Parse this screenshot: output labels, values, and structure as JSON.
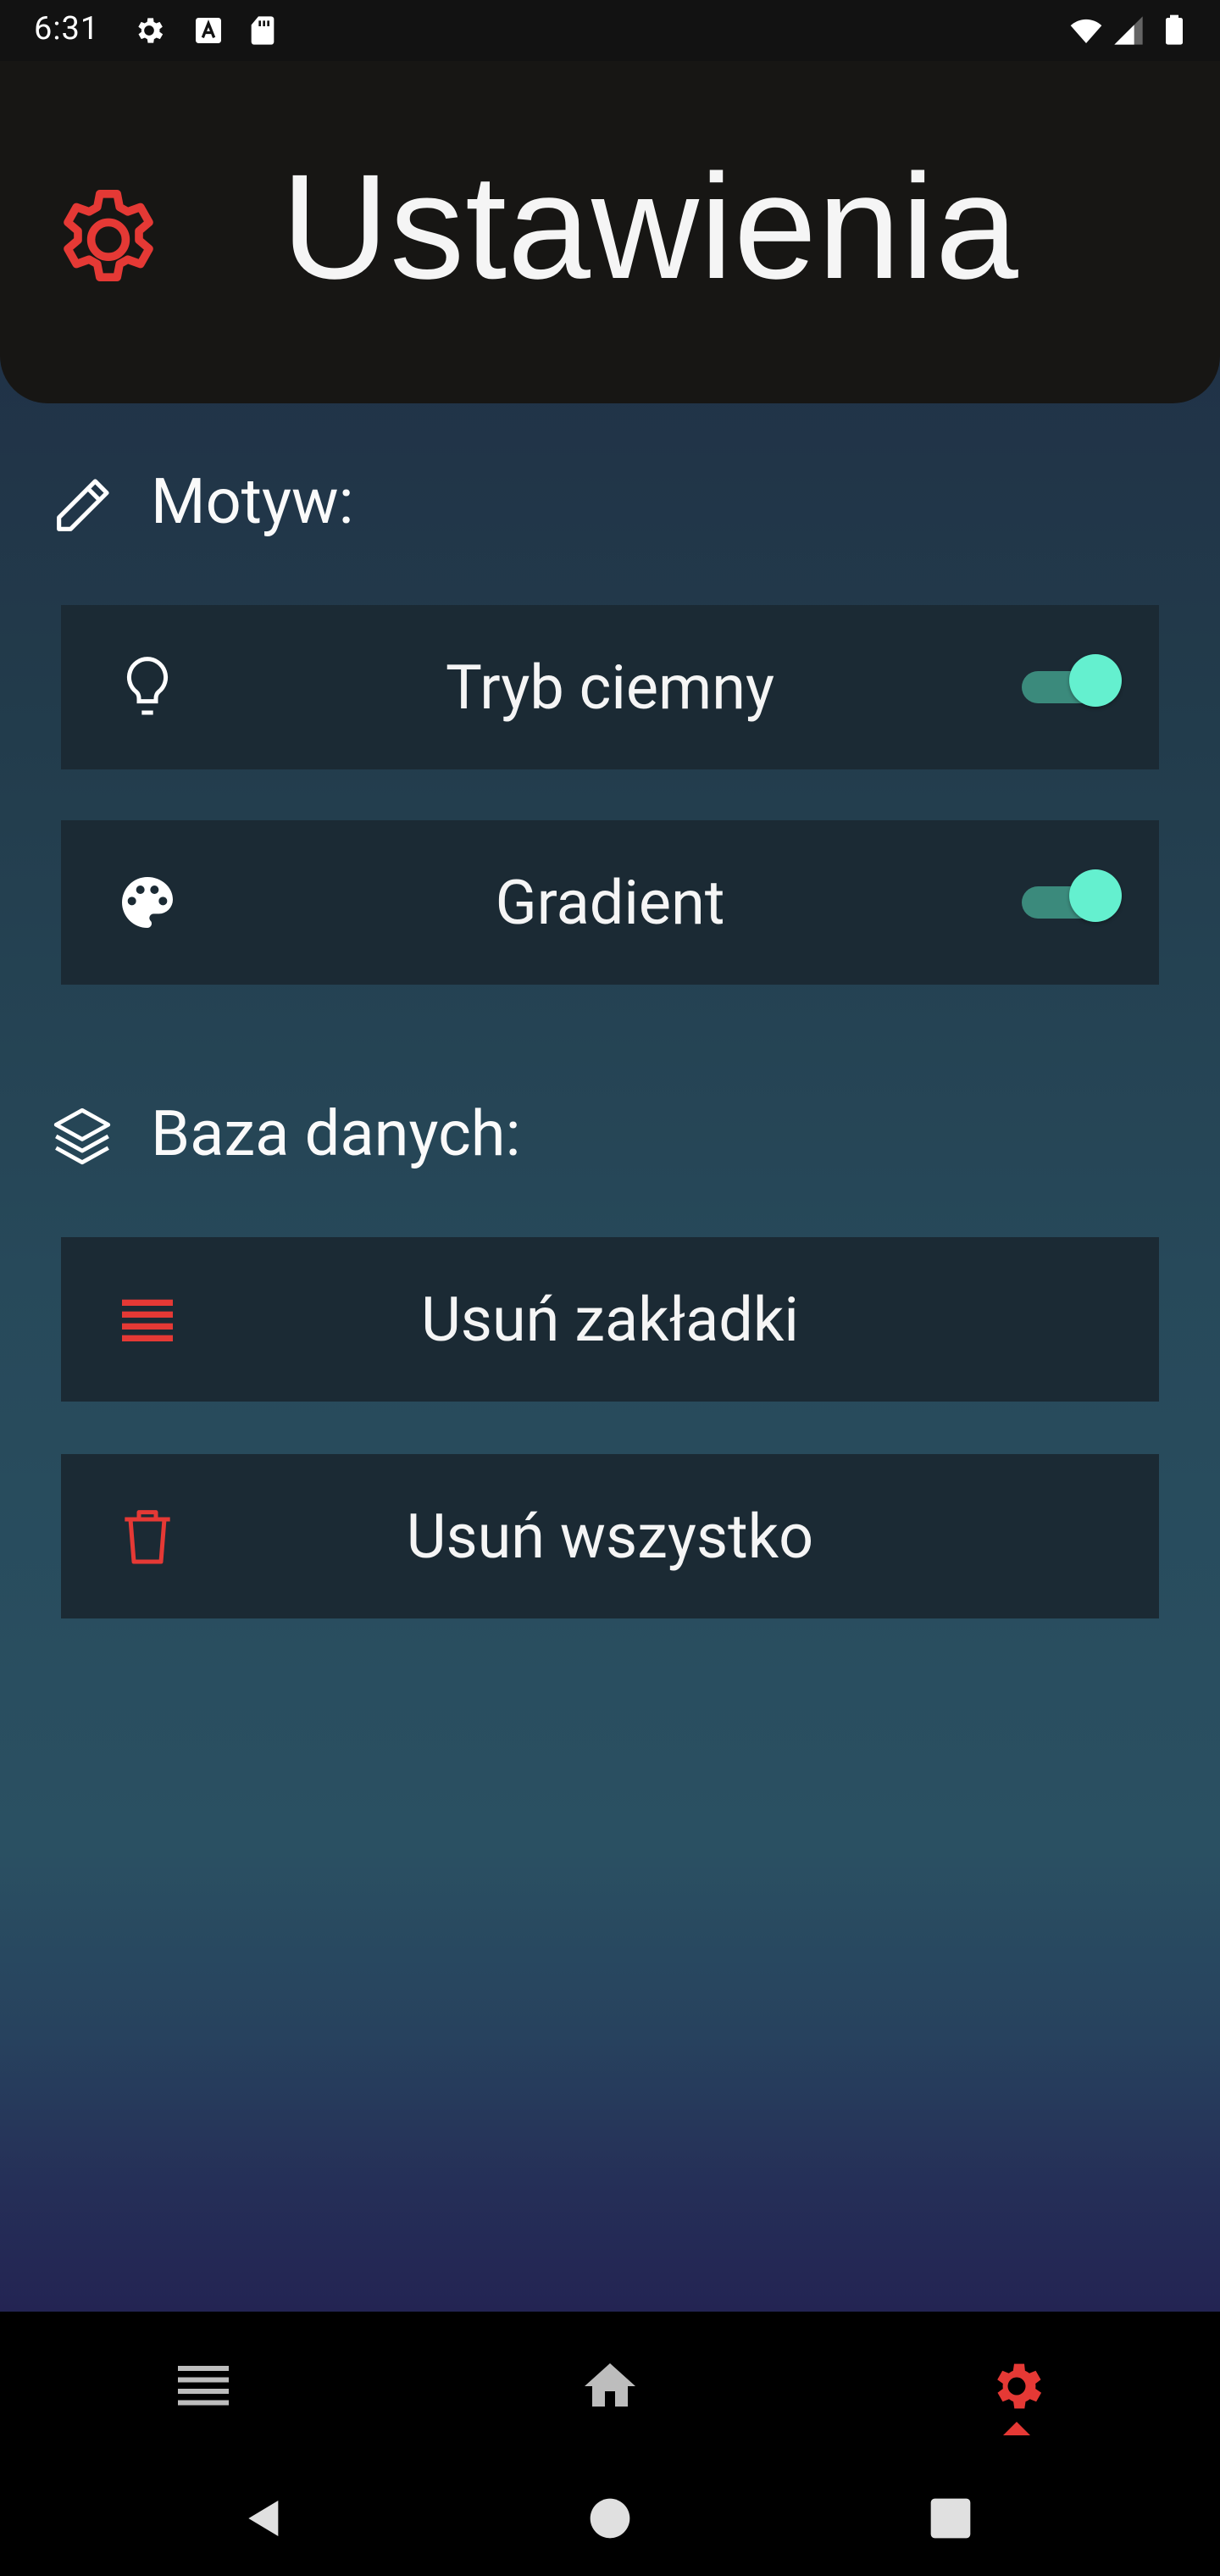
{
  "status_bar": {
    "time": "6:31",
    "left_icons": [
      "settings-icon",
      "a-icon",
      "sd-card-icon"
    ],
    "right_icons": [
      "wifi-icon",
      "signal-icon",
      "battery-icon"
    ]
  },
  "header": {
    "title": "Ustawienia",
    "icon": "gear-icon",
    "accent_color": "#e53935"
  },
  "sections": {
    "theme": {
      "title": "Motyw:",
      "icon": "pencil-icon",
      "items": [
        {
          "label": "Tryb ciemny",
          "icon": "lightbulb-icon",
          "toggle": true
        },
        {
          "label": "Gradient",
          "icon": "palette-icon",
          "toggle": true
        }
      ]
    },
    "database": {
      "title": "Baza danych:",
      "icon": "layers-icon",
      "items": [
        {
          "label": "Usuń zakładki",
          "icon": "list-icon",
          "icon_color": "#e53935"
        },
        {
          "label": "Usuń wszystko",
          "icon": "trash-icon",
          "icon_color": "#e53935"
        }
      ]
    }
  },
  "bottom_nav": {
    "items": [
      {
        "icon": "list-icon",
        "active": false
      },
      {
        "icon": "home-icon",
        "active": false
      },
      {
        "icon": "settings-icon",
        "active": true
      }
    ],
    "active_color": "#e53935",
    "inactive_color": "#bdbdbd"
  },
  "system_nav": [
    "back-icon",
    "home-circle-icon",
    "recents-icon"
  ],
  "colors": {
    "toggle_on_knob": "#64f0cf",
    "toggle_on_track": "#3b8a7c",
    "card_bg": "#1b2a34"
  }
}
